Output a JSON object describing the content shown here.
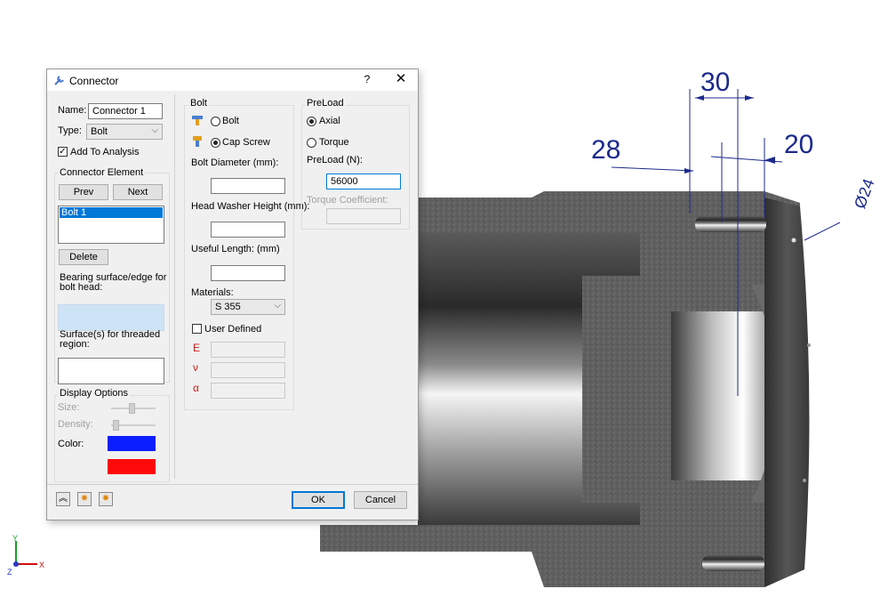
{
  "dimensions": {
    "d30": "30",
    "d28": "28",
    "d20": "20",
    "d24": "Ø24"
  },
  "dialog": {
    "title": "Connector",
    "help": "?",
    "close": "✕",
    "left": {
      "name_label": "Name:",
      "name_value": "Connector 1",
      "type_label": "Type:",
      "type_value": "Bolt",
      "add_to_analysis": "Add To Analysis",
      "connector_element_title": "Connector Element",
      "prev": "Prev",
      "next": "Next",
      "list_items": [
        "Bolt 1"
      ],
      "delete": "Delete",
      "bearing_label_1": "Bearing surface/edge for",
      "bearing_label_2": "bolt head:",
      "surfaces_label_1": "Surface(s) for threaded",
      "surfaces_label_2": "region:",
      "display_options_title": "Display Options",
      "size_label": "Size:",
      "density_label": "Density:",
      "color_label": "Color:",
      "color_1": "#0a1eff",
      "color_2": "#ff0a0a"
    },
    "bolt": {
      "title": "Bolt",
      "option_bolt": "Bolt",
      "option_cap_screw": "Cap Screw",
      "selected": "Cap Screw",
      "diameter_label": "Bolt Diameter (mm):",
      "washer_label": "Head Washer Height (mm):",
      "useful_length_label": "Useful Length: (mm)",
      "materials_label": "Materials:",
      "material_value": "S 355",
      "user_defined": "User Defined",
      "E": "E",
      "nu": "ν",
      "alpha": "α"
    },
    "preload": {
      "title": "PreLoad",
      "option_axial": "Axial",
      "option_torque": "Torque",
      "selected": "Axial",
      "preload_label": "PreLoad (N):",
      "preload_value": "56000",
      "torque_coeff_label": "Torque Coefficient:"
    },
    "footer": {
      "ok": "OK",
      "cancel": "Cancel"
    }
  },
  "triad": {
    "x": "X",
    "y": "Y",
    "z": "Z"
  }
}
